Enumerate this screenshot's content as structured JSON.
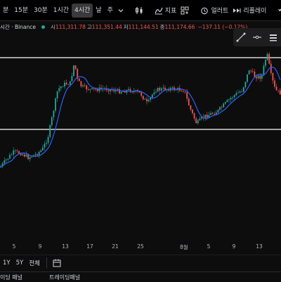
{
  "toolbar": {
    "intervals": [
      {
        "label": "분",
        "active": false
      },
      {
        "label": "15분",
        "active": false
      },
      {
        "label": "30분",
        "active": false
      },
      {
        "label": "1시간",
        "active": false
      },
      {
        "label": "4시간",
        "active": true
      },
      {
        "label": "날",
        "active": false
      },
      {
        "label": "주",
        "active": false
      }
    ],
    "indicators_label": "지표",
    "alert_label": "얼러트",
    "replay_label": "리플레이"
  },
  "infobar": {
    "symbol": "시간 · Binance",
    "open_label": "시",
    "open": "111,311.78",
    "high_label": "고",
    "high": "111,351.44",
    "low_label": "저",
    "low": "111,144.51",
    "close_label": "종",
    "close": "111,174.66",
    "change": "−137.11 (−0.12%)"
  },
  "xaxis": {
    "labels": [
      "5",
      "9",
      "13",
      "17",
      "21",
      "25",
      "8월",
      "5",
      "9",
      "13"
    ]
  },
  "bottombar": {
    "ranges": [
      "1Y",
      "5Y",
      "전체"
    ]
  },
  "panels": {
    "left": "이딩 패널",
    "right": "트레이딩패널"
  },
  "colors": {
    "up": "#26a69a",
    "down": "#ef5350",
    "ma": "#2962ff"
  }
}
